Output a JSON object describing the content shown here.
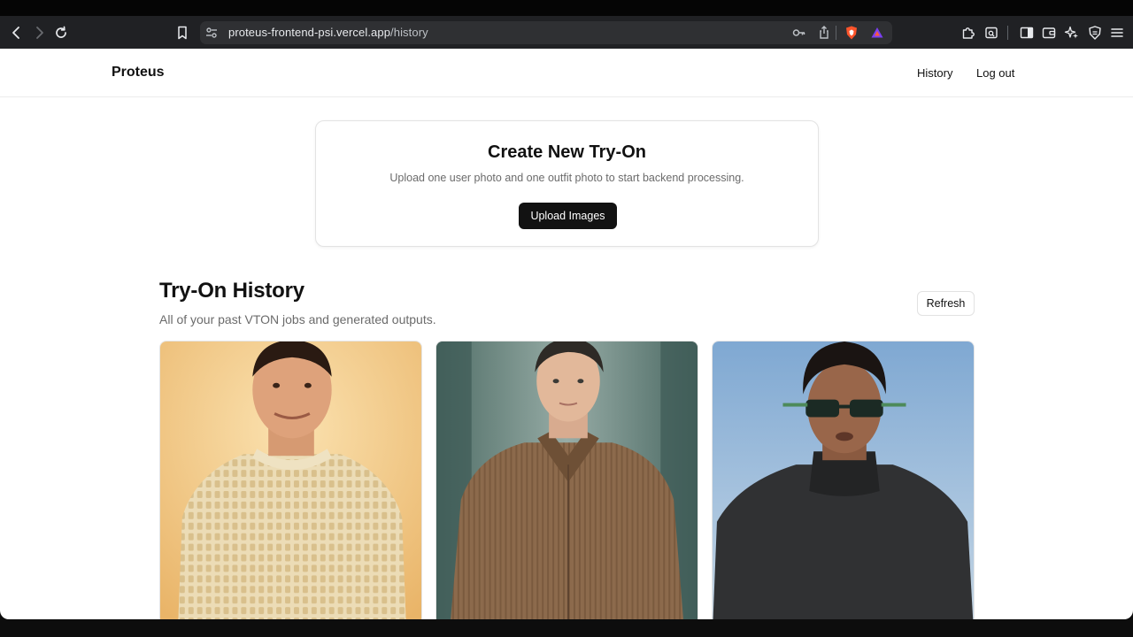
{
  "browser": {
    "url_host": "proteus-frontend-psi.vercel.app",
    "url_path": "/history",
    "icons": [
      "back-icon",
      "forward-icon",
      "reload-icon",
      "bookmark-icon",
      "site-settings-icon",
      "key-icon",
      "share-icon",
      "brave-shields-icon",
      "brave-rewards-icon",
      "extensions-icon",
      "screenshot-icon",
      "sidebar-icon",
      "wallet-icon",
      "leo-ai-icon",
      "vpn-icon",
      "menu-icon"
    ]
  },
  "nav": {
    "brand": "Proteus",
    "history_link": "History",
    "logout_link": "Log out"
  },
  "create": {
    "title": "Create New Try-On",
    "subtitle": "Upload one user photo and one outfit photo to start backend processing.",
    "upload_label": "Upload Images"
  },
  "history": {
    "title": "Try-On History",
    "subtitle": "All of your past VTON jobs and generated outputs.",
    "refresh_label": "Refresh",
    "items": [
      {
        "subject": "man in cream knit sweater",
        "bg": "#f2c98a",
        "garment": "#e8d5b0"
      },
      {
        "subject": "man in brown button-up shirt",
        "bg": "#7a8f86",
        "garment": "#8a6a4a"
      },
      {
        "subject": "man in black turtleneck with sunglasses",
        "bg": "#8fb3d6",
        "garment": "#2e2e2e"
      }
    ]
  }
}
